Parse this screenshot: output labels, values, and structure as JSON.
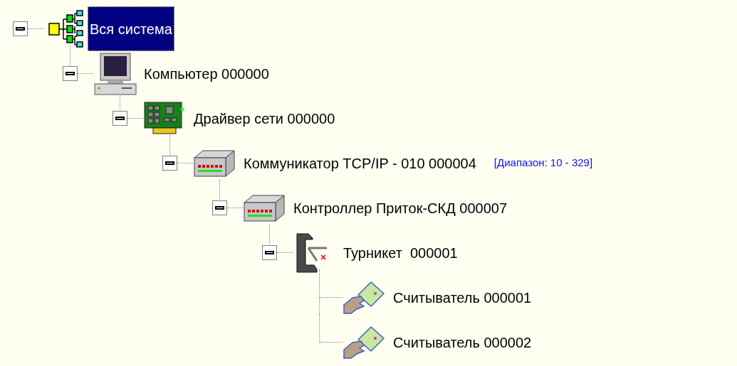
{
  "tree": {
    "items": [
      {
        "label": "Вся система",
        "kind": "system",
        "selected": true,
        "expanded": true,
        "children": [
          {
            "label": "Компьютер 000000",
            "kind": "computer",
            "selected": false,
            "expanded": true,
            "children": [
              {
                "label": "Драйвер сети 000000",
                "kind": "network-card",
                "selected": false,
                "expanded": true,
                "children": [
                  {
                    "label": "Коммуникатор TCP/IP - 010 000004",
                    "note": "[Диапазон: 10 - 329]",
                    "kind": "communicator",
                    "selected": false,
                    "expanded": true,
                    "children": [
                      {
                        "label": "Контроллер Приток-СКД 000007",
                        "kind": "controller",
                        "selected": false,
                        "expanded": true,
                        "children": [
                          {
                            "label": "Турникет  000001",
                            "kind": "turnstile",
                            "selected": false,
                            "expanded": true,
                            "children": [
                              {
                                "label": "Считыватель 000001",
                                "kind": "reader",
                                "selected": false
                              },
                              {
                                "label": "Считыватель 000002",
                                "kind": "reader",
                                "selected": false
                              }
                            ]
                          }
                        ]
                      }
                    ]
                  }
                ]
              }
            ]
          }
        ]
      }
    ]
  }
}
